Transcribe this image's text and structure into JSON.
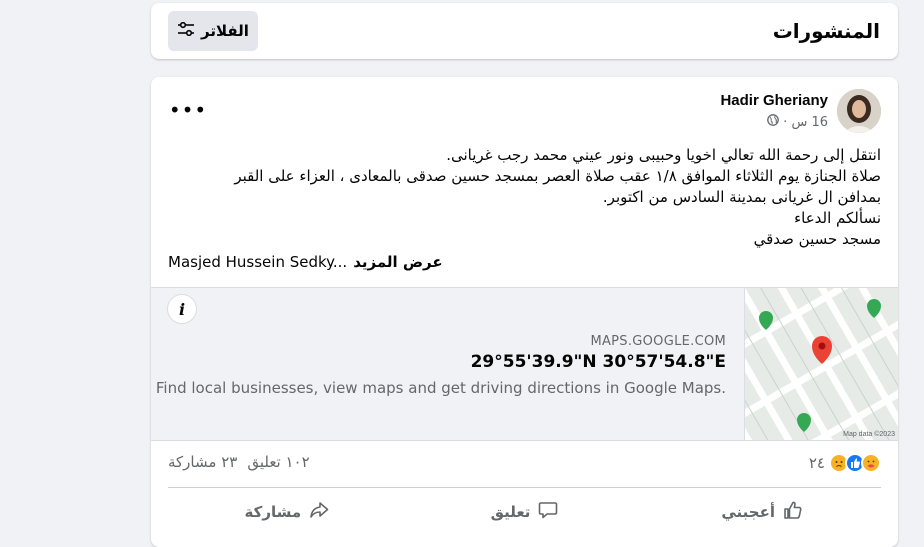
{
  "header": {
    "title": "المنشورات",
    "filter_label": "الفلاتر",
    "filter_icon": "sliders-icon"
  },
  "post": {
    "author": "Hadir Gheriany",
    "time": "16 س",
    "separator": "·",
    "privacy_icon": "globe-icon",
    "more_label": "•••",
    "text_lines": [
      "انتقل إلى رحمة الله تعالي اخويا وحبيبى ونور عيني محمد رجب غريانى.",
      "صلاة الجنازة يوم الثلاثاء الموافق ١/٨ عقب صلاة العصر بمسجد حسين صدقى بالمعادى ، العزاء على القبر",
      "بمدافن ال غريانى بمدينة السادس من اكتوبر.",
      "نسألكم الدعاء",
      "مسجد حسين صدقي"
    ],
    "see_more_prefix": "Masjed Hussein Sedky...",
    "see_more_label": "عرض المزيد",
    "link": {
      "domain": "MAPS.GOOGLE.COM",
      "title": "29°55'39.9\"N 30°57'54.8\"E",
      "description": "Find local businesses, view maps and get driving directions in Google Maps.",
      "info_label": "i",
      "map_attribution": "Map data ©2023"
    },
    "reactions_count": "٢٤",
    "comments_count": "١٠٢ تعليق",
    "shares_count": "٢٣ مشاركة",
    "actions": {
      "like": "أعجبني",
      "comment": "تعليق",
      "share": "مشاركة"
    }
  },
  "colors": {
    "background": "#f0f2f5",
    "card": "#ffffff",
    "secondary_text": "#65676b",
    "like_blue": "#1877f2",
    "map_pin_red": "#ea4335",
    "map_poi_green": "#34a853"
  }
}
